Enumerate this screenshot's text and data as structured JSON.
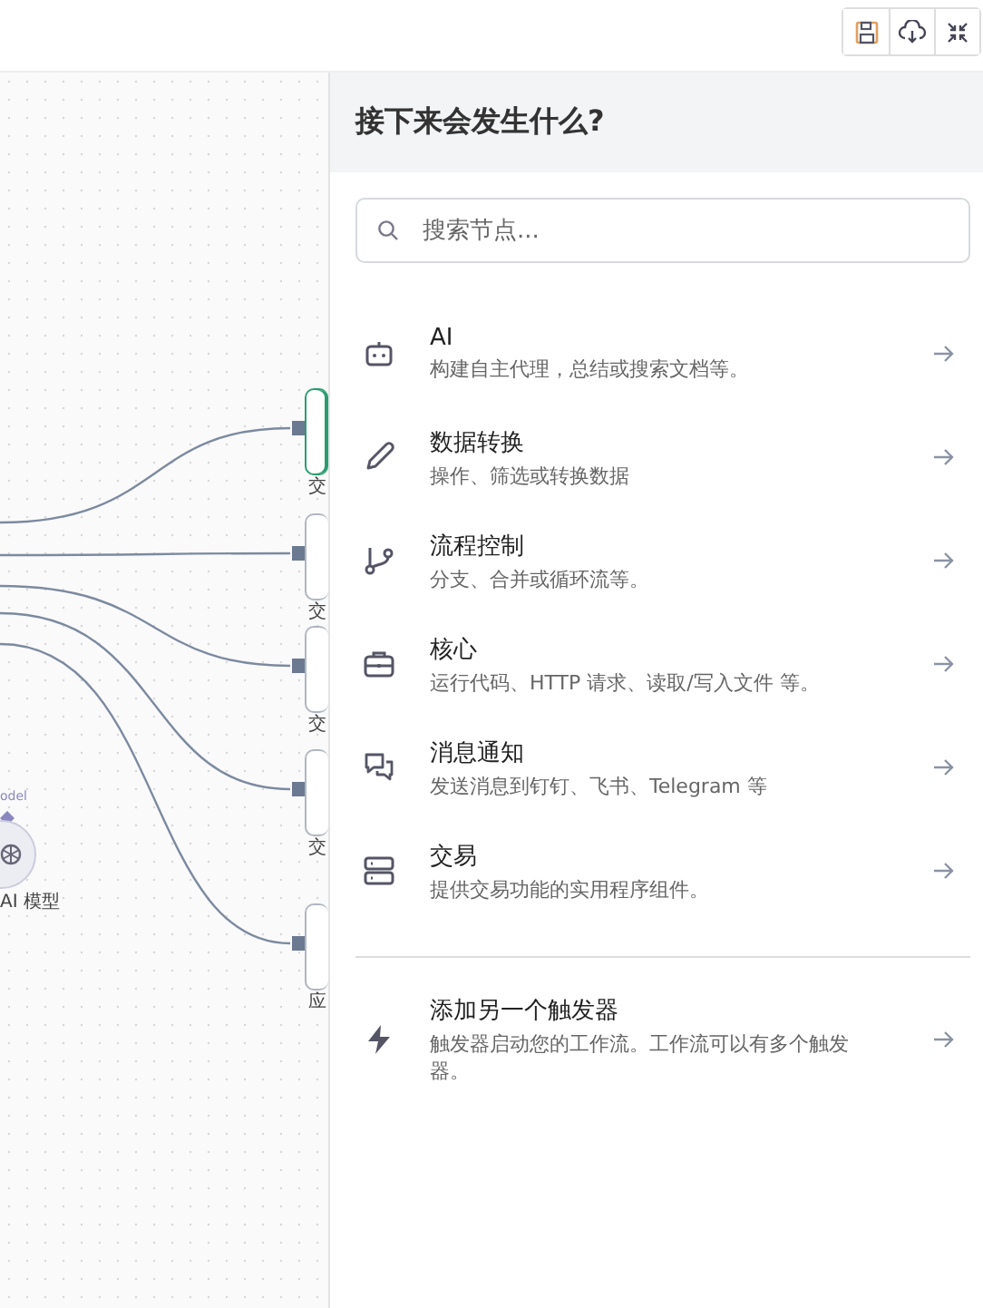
{
  "toolbar": {
    "buttons": [
      {
        "kind": "save"
      },
      {
        "kind": "upload"
      },
      {
        "kind": "collapse"
      }
    ]
  },
  "canvas": {
    "nodes": [
      {
        "label": "交",
        "selected": true
      },
      {
        "label": "交",
        "selected": false
      },
      {
        "label": "交",
        "selected": false
      },
      {
        "label": "交",
        "selected": false
      },
      {
        "label": "应",
        "selected": false
      }
    ],
    "model_node": {
      "label": "AI 模型",
      "port_label": "odel"
    }
  },
  "panel": {
    "title": "接下来会发生什么?",
    "search": {
      "placeholder": "搜索节点..."
    },
    "items": [
      {
        "kind": "robot",
        "title": "AI",
        "description": "构建自主代理，总结或搜索文档等。"
      },
      {
        "kind": "pencil",
        "title": "数据转换",
        "description": "操作、筛选或转换数据"
      },
      {
        "kind": "branch",
        "title": "流程控制",
        "description": "分支、合并或循环流等。"
      },
      {
        "kind": "toolbox",
        "title": "核心",
        "description": "运行代码、HTTP 请求、读取/写入文件 等。"
      },
      {
        "kind": "chat",
        "title": "消息通知",
        "description": "发送消息到钉钉、飞书、Telegram 等"
      },
      {
        "kind": "server",
        "title": "交易",
        "description": "提供交易功能的实用程序组件。"
      }
    ],
    "trigger": {
      "kind": "bolt",
      "title": "添加另一个触发器",
      "description": "触发器启动您的工作流。工作流可以有多个触发器。"
    }
  }
}
